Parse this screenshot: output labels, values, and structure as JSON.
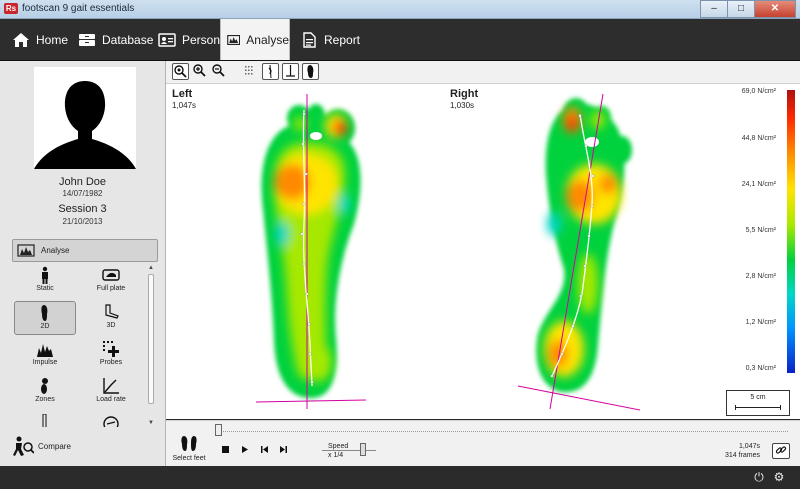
{
  "window": {
    "title": "footscan 9 gait essentials",
    "logo": "Rs",
    "minimize": "–",
    "maximize": "□",
    "close": "✕"
  },
  "nav": {
    "items": [
      {
        "label": "Home",
        "icon": "home-icon"
      },
      {
        "label": "Database",
        "icon": "database-icon"
      },
      {
        "label": "Person",
        "icon": "person-card-icon"
      },
      {
        "label": "Analyse",
        "icon": "analyse-icon",
        "active": true
      },
      {
        "label": "Report",
        "icon": "report-icon"
      }
    ]
  },
  "person": {
    "name": "John Doe",
    "dob": "14/07/1982",
    "session": "Session 3",
    "session_date": "21/10/2013"
  },
  "sidebar": {
    "section_label": "Analyse",
    "tools": [
      {
        "label": "Static",
        "icon": "person-standing-icon"
      },
      {
        "label": "Full plate",
        "icon": "full-plate-icon"
      },
      {
        "label": "2D",
        "icon": "footprint-2d-icon",
        "selected": true
      },
      {
        "label": "3D",
        "icon": "foot-3d-icon"
      },
      {
        "label": "Impulse",
        "icon": "impulse-chart-icon"
      },
      {
        "label": "Probes",
        "icon": "probes-icon"
      },
      {
        "label": "Zones",
        "icon": "zones-icon"
      },
      {
        "label": "Load rate",
        "icon": "load-rate-icon"
      }
    ],
    "compare_label": "Compare"
  },
  "toolbar": {
    "tools": [
      "zoom-fit-icon",
      "zoom-in-icon",
      "zoom-out-icon",
      "grid-icon",
      "foot-axis-icon",
      "foot-line-icon",
      "foot-outline-icon"
    ]
  },
  "analysis": {
    "left": {
      "label": "Left",
      "time": "1,047s"
    },
    "right": {
      "label": "Right",
      "time": "1,030s"
    },
    "scale_labels": [
      "69,0 N/cm²",
      "44,8 N/cm²",
      "24,1 N/cm²",
      "5,5 N/cm²",
      "2,8 N/cm²",
      "1,2 N/cm²",
      "0,3 N/cm²"
    ],
    "scale_bar": "5 cm",
    "colors": {
      "max": "#b01010",
      "high": "#ff8a00",
      "mid": "#ffe400",
      "low": "#00d23c",
      "min": "#0a20c8"
    }
  },
  "playback": {
    "select_feet": "Select feet",
    "speed_label": "Speed",
    "speed_value": "x 1/4",
    "time": "1,047s",
    "frames": "314 frames",
    "progress": 0.0
  }
}
